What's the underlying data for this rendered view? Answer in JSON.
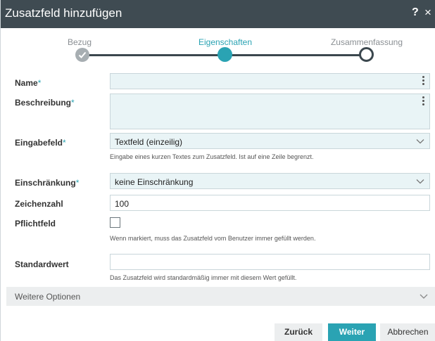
{
  "dialog": {
    "title": "Zusatzfeld hinzufügen",
    "help": "?",
    "close": "×"
  },
  "steps": [
    {
      "label": "Bezug",
      "state": "done"
    },
    {
      "label": "Eigenschaften",
      "state": "active"
    },
    {
      "label": "Zusammenfassung",
      "state": "pending"
    }
  ],
  "form": {
    "required_marker": "*",
    "name": {
      "label": "Name",
      "value": ""
    },
    "description": {
      "label": "Beschreibung",
      "value": ""
    },
    "input_type": {
      "label": "Eingabefeld",
      "value": "Textfeld (einzeilig)",
      "hint": "Eingabe eines kurzen Textes zum Zusatzfeld. Ist auf eine Zeile begrenzt."
    },
    "restriction": {
      "label": "Einschränkung",
      "value": "keine Einschränkung"
    },
    "char_count": {
      "label": "Zeichenzahl",
      "value": "100"
    },
    "mandatory": {
      "label": "Pflichtfeld",
      "checked": false,
      "hint": "Wenn markiert, muss das Zusatzfeld vom Benutzer immer gefüllt werden."
    },
    "default_value": {
      "label": "Standardwert",
      "value": "",
      "hint": "Das Zusatzfeld wird standardmäßig immer mit diesem Wert gefüllt."
    }
  },
  "more_options": {
    "label": "Weitere Optionen",
    "icon": "chevron-down-icon"
  },
  "buttons": {
    "back": "Zurück",
    "next": "Weiter",
    "cancel": "Abbrechen"
  },
  "colors": {
    "accent": "#2aa3b3",
    "titlebar": "#3f4b52",
    "field_bg": "#e9f4f6"
  }
}
